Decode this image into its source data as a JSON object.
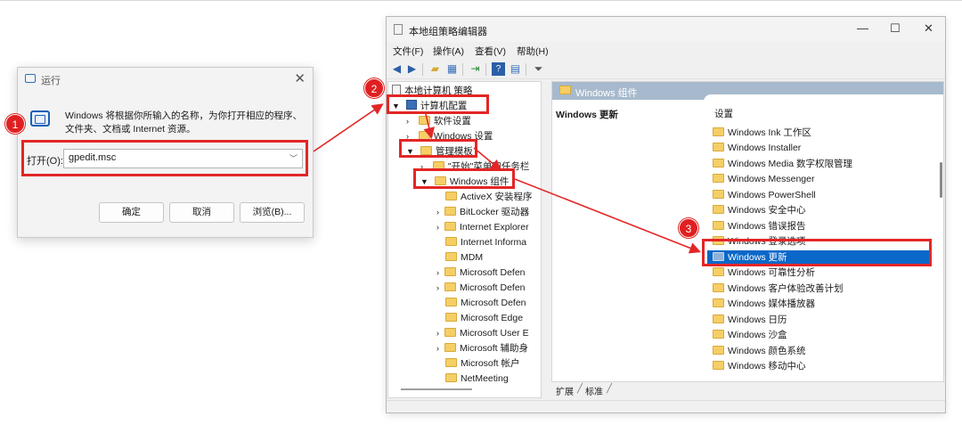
{
  "colors": {
    "annotation_red": "#e32626",
    "selection_blue": "#0a68c8",
    "panel_header": "#a7bacd"
  },
  "run_dialog": {
    "title": "运行",
    "description": "Windows 将根据你所输入的名称，为你打开相应的程序、文件夹、文档或 Internet 资源。",
    "open_label": "打开(O):",
    "input_value": "gpedit.msc",
    "ok": "确定",
    "cancel": "取消",
    "browse": "浏览(B)...",
    "close_glyph": "✕"
  },
  "gpedit": {
    "title": "本地组策略编辑器",
    "window_controls": {
      "minimize": "—",
      "maximize": "☐",
      "close": "✕"
    },
    "menu": [
      "文件(F)",
      "操作(A)",
      "查看(V)",
      "帮助(H)"
    ],
    "toolbar_icons": [
      "back-arrow-icon",
      "forward-arrow-icon",
      "folder-up-icon",
      "show-hide-tree-icon",
      "export-list-icon",
      "help-icon",
      "properties-icon",
      "filter-icon"
    ],
    "tree": {
      "root": "本地计算机 策略",
      "computer_config": "计算机配置",
      "software_settings": "软件设置",
      "windows_settings": "Windows 设置",
      "admin_templates": "管理模板",
      "start_menu": "\"开始\"菜单和任务栏",
      "windows_components": "Windows 组件",
      "children": [
        "ActiveX 安装程序",
        "BitLocker 驱动器",
        "Internet Explorer",
        "Internet Informa",
        "MDM",
        "Microsoft Defen",
        "Microsoft Defen",
        "Microsoft Defen",
        "Microsoft Edge",
        "Microsoft User E",
        "Microsoft 辅助身",
        "Microsoft 帐户",
        "NetMeeting"
      ]
    },
    "right_panel": {
      "header": "Windows 组件",
      "left_title": "Windows 更新",
      "list_header": "设置",
      "items": [
        "Windows Ink 工作区",
        "Windows Installer",
        "Windows Media 数字权限管理",
        "Windows Messenger",
        "Windows PowerShell",
        "Windows 安全中心",
        "Windows 错误报告",
        "Windows 登录选项",
        "Windows 更新",
        "Windows 可靠性分析",
        "Windows 客户体验改善计划",
        "Windows 媒体播放器",
        "Windows 日历",
        "Windows 沙盒",
        "Windows 颜色系统",
        "Windows 移动中心"
      ],
      "selected_item": "Windows 更新"
    },
    "tabs": [
      "扩展",
      "标准"
    ]
  },
  "annotations": {
    "badge1": "1",
    "badge2": "2",
    "badge3": "3"
  }
}
